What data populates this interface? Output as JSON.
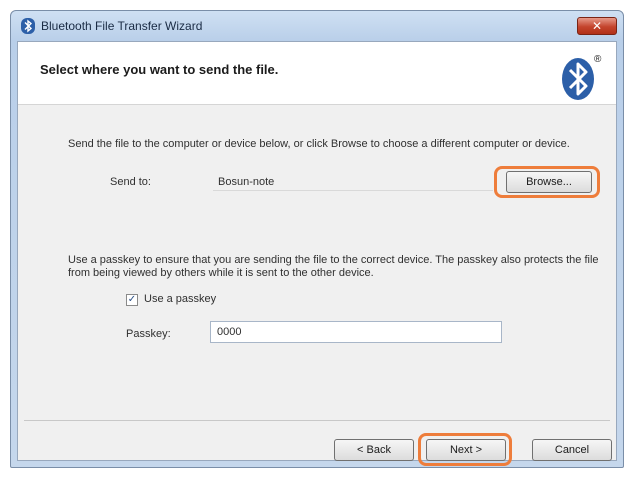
{
  "window": {
    "title": "Bluetooth File Transfer Wizard",
    "close_label": "✕"
  },
  "header": {
    "title": "Select where you want to send the file.",
    "logo_icon": "bluetooth-logo-icon",
    "registered_mark": "®"
  },
  "send_section": {
    "description": "Send the file to the computer or device below, or click Browse to choose a different computer or device.",
    "send_to_label": "Send to:",
    "send_to_value": "Bosun-note",
    "browse_label": "Browse..."
  },
  "passkey_section": {
    "description": "Use a passkey to ensure that you are sending the file to the correct device.  The passkey also protects the file from being viewed by others while it is sent to the other device.",
    "use_passkey_label": "Use a passkey",
    "use_passkey_checked": true,
    "passkey_label": "Passkey:",
    "passkey_value": "0000"
  },
  "footer": {
    "back_label": "< Back",
    "next_label": "Next >",
    "cancel_label": "Cancel"
  },
  "colors": {
    "highlight": "#ee7d3b",
    "bluetooth_blue": "#2c5fa8"
  }
}
